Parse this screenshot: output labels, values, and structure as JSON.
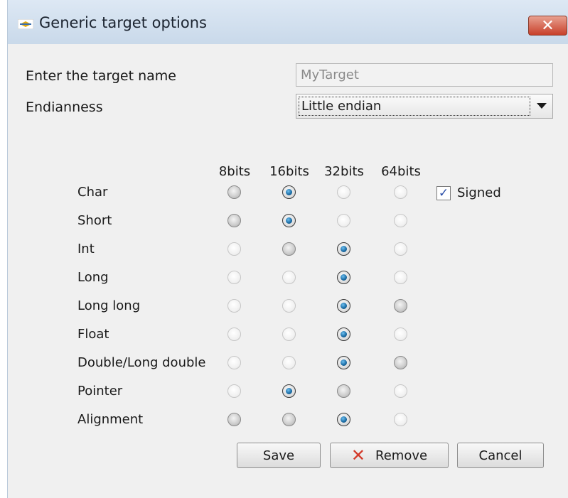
{
  "window": {
    "title": "Generic target options",
    "close_label": "✕"
  },
  "form": {
    "target_name_label": "Enter the target name",
    "target_name_value": "MyTarget",
    "endianness_label": "Endianness",
    "endianness_value": "Little endian"
  },
  "grid": {
    "columns": [
      "8bits",
      "16bits",
      "32bits",
      "64bits"
    ],
    "rows": [
      {
        "label": "Char",
        "selected": "16bits",
        "states": [
          "gray",
          "on",
          "off",
          "off"
        ]
      },
      {
        "label": "Short",
        "selected": "16bits",
        "states": [
          "gray",
          "on",
          "off",
          "off"
        ]
      },
      {
        "label": "Int",
        "selected": "32bits",
        "states": [
          "off",
          "gray",
          "on",
          "off"
        ]
      },
      {
        "label": "Long",
        "selected": "32bits",
        "states": [
          "off",
          "off",
          "on",
          "off"
        ]
      },
      {
        "label": "Long long",
        "selected": "32bits",
        "states": [
          "off",
          "off",
          "on",
          "gray"
        ]
      },
      {
        "label": "Float",
        "selected": "32bits",
        "states": [
          "off",
          "off",
          "on",
          "off"
        ]
      },
      {
        "label": "Double/Long double",
        "selected": "32bits",
        "states": [
          "off",
          "off",
          "on",
          "gray"
        ]
      },
      {
        "label": "Pointer",
        "selected": "16bits",
        "states": [
          "off",
          "on",
          "gray",
          "off"
        ]
      },
      {
        "label": "Alignment",
        "selected": "32bits",
        "states": [
          "gray",
          "gray",
          "on",
          "off"
        ]
      }
    ],
    "signed_label": "Signed",
    "signed_checked": true
  },
  "buttons": {
    "save": "Save",
    "remove": "Remove",
    "cancel": "Cancel"
  },
  "colors": {
    "accent_radio": "#1d6fa8",
    "remove_icon": "#d33a2a",
    "close_button": "#c8402a"
  }
}
